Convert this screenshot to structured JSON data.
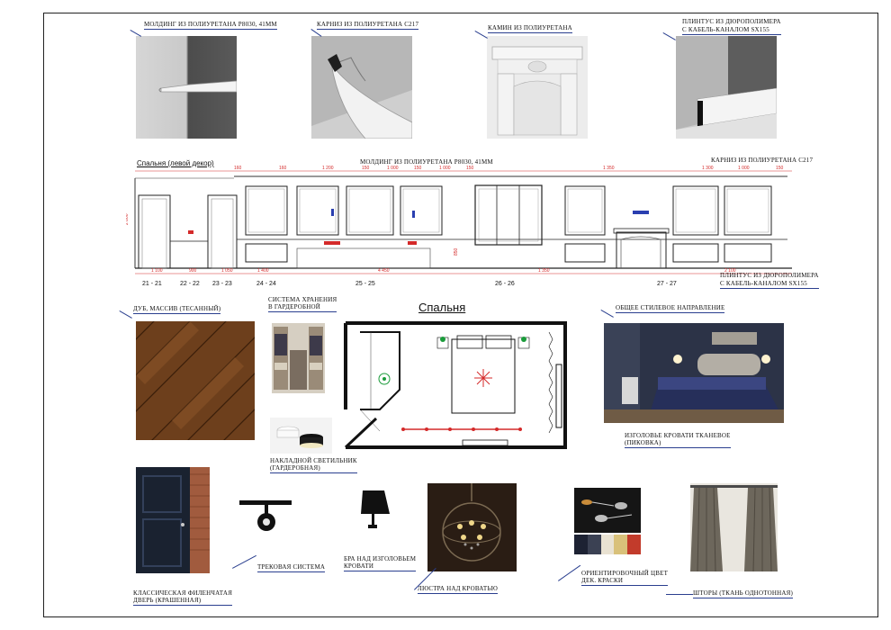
{
  "moldings": [
    {
      "label": "МОЛДИНГ ИЗ ПОЛИУРЕТАНА Р8030, 41мм",
      "icon": "molding-photo"
    },
    {
      "label": "КАРНИЗ ИЗ ПОЛИУРЕТАНА С217",
      "icon": "cornice-photo"
    },
    {
      "label": "КАМИН ИЗ ПОЛИУРЕТАНА",
      "icon": "fireplace-photo"
    },
    {
      "label_line1": "ПЛИНТУС ИЗ ДЮРОПОЛИМЕРА",
      "label_line2": "С КАБЕЛЬ-КАНАЛОМ SX155",
      "icon": "baseboard-photo"
    }
  ],
  "elevation": {
    "title": "Спальня (левой декор)",
    "molding_note": "МОЛДИНГ ИЗ ПОЛИУРЕТАНА Р8030, 41мм",
    "cornice_note": "КАРНИЗ ИЗ ПОЛИУРЕТАНА С217",
    "baseboard_note_line1": "ПЛИНТУС ИЗ ДЮРОПОЛИМЕРА",
    "baseboard_note_line2": "С КАБЕЛЬ-КАНАЛОМ SX155",
    "sections": [
      "21 - 21",
      "22 - 22",
      "23 - 23",
      "24 - 24",
      "25 - 25",
      "26 - 26",
      "27 - 27"
    ]
  },
  "plan": {
    "title": "Спальня"
  },
  "materials": {
    "oak": "ДУБ, МАССИВ (ТЕСАННЫЙ)",
    "wardrobe_line1": "СИСТЕМА ХРАНЕНИЯ",
    "wardrobe_line2": "В ГАРДЕРОБНОЙ",
    "style": "ОБЩЕЕ СТИЛЕВОЕ НАПРАВЛЕНИЕ",
    "bed_line1": "ИЗГОЛОВЬЕ КРОВАТИ ТКАНЕВОЕ",
    "bed_line2": "(ПИКОВКА)",
    "light_line1": "НАКЛАДНОЙ СВЕТИЛЬНИК",
    "light_line2": "(ГАРДЕРОБНАЯ)",
    "door_line1": "КЛАССИЧЕСКАЯ ФИЛЕНЧАТАЯ",
    "door_line2": "ДВЕРЬ (КРАШЕННАЯ)",
    "track": "ТРЕКОВАЯ СИСТЕМА",
    "sconce_line1": "БРА НАД ИЗГОЛОВЬЕМ",
    "sconce_line2": "КРОВАТИ",
    "chandelier": "ЛЮСТРА НАД КРОВАТЬЮ",
    "paint_line1": "ОРИЕНТИРОВОЧНЫЙ ЦВЕТ",
    "paint_line2": "ДЕК. КРАСКИ",
    "curtains": "ШТОРЫ (ТКАНЬ ОДНОТОННАЯ)"
  },
  "palette": [
    "#1d2233",
    "#3b4153",
    "#e9e2d2",
    "#d9c17a",
    "#c23b2b"
  ]
}
